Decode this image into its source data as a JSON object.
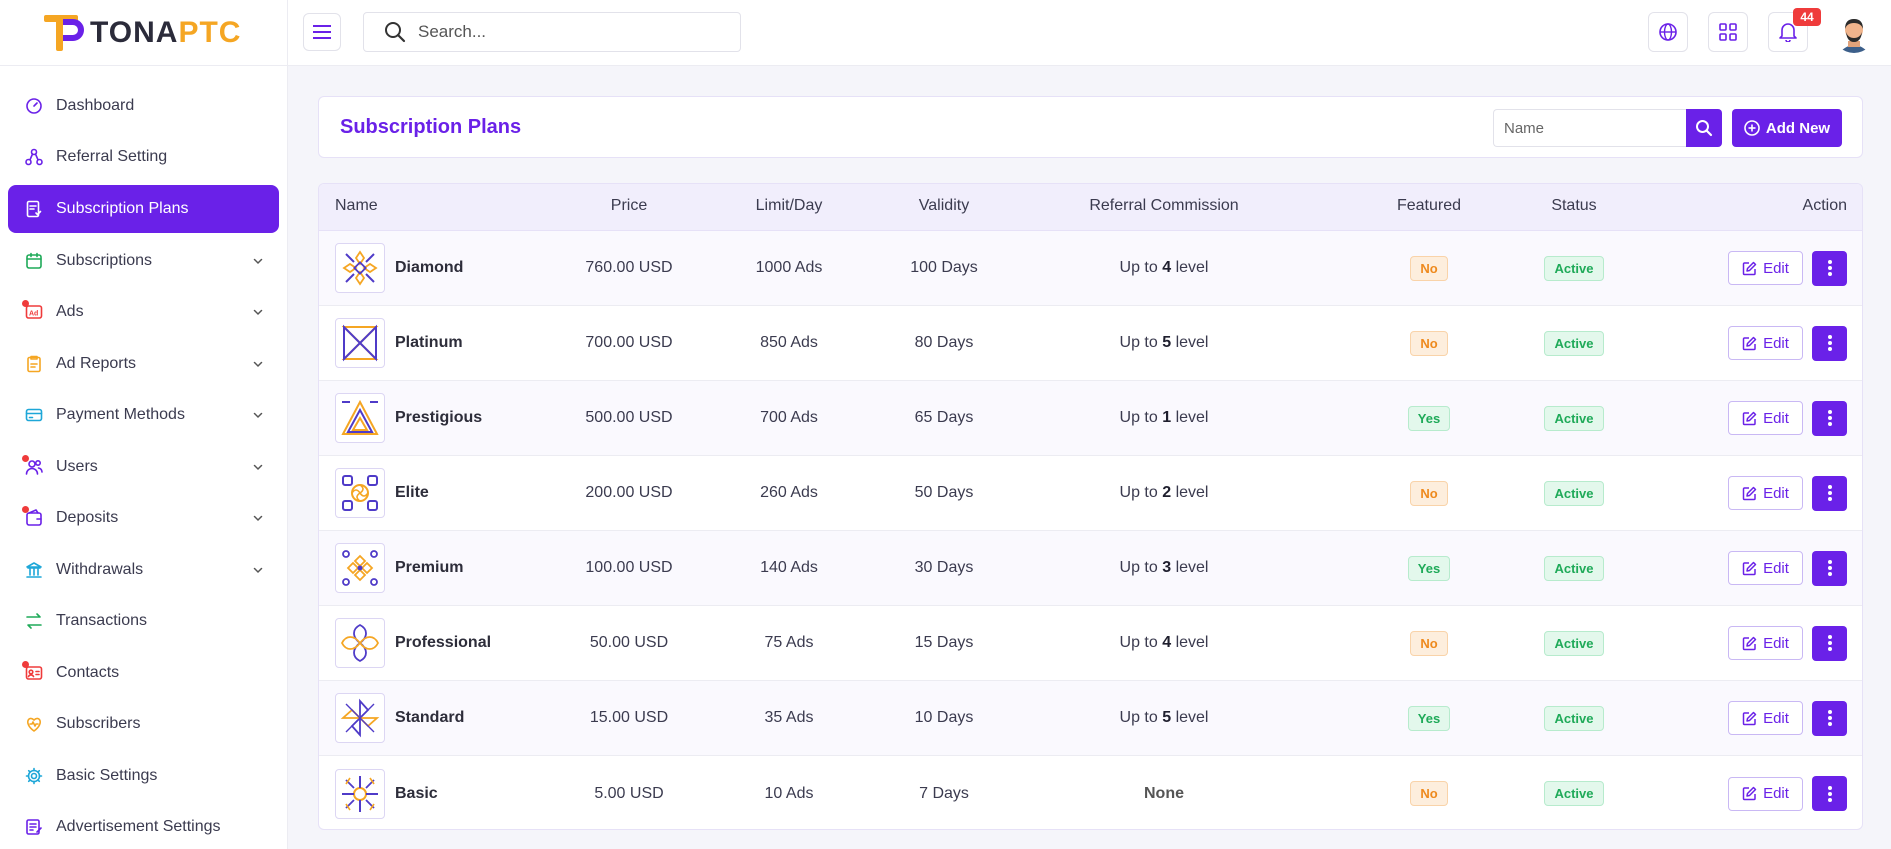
{
  "brand": {
    "name_part1": "TONA",
    "name_part2": "PTC"
  },
  "header": {
    "search_placeholder": "Search...",
    "notification_count": "44"
  },
  "sidebar": {
    "items": [
      {
        "label": "Dashboard",
        "icon": "dashboard-icon",
        "color": "#6a21e8",
        "has_chevron": false,
        "dot": false
      },
      {
        "label": "Referral Setting",
        "icon": "referral-icon",
        "color": "#6a21e8",
        "has_chevron": false,
        "dot": false
      },
      {
        "label": "Subscription Plans",
        "icon": "plans-icon",
        "color": "#ffffff",
        "has_chevron": false,
        "dot": false,
        "active": true
      },
      {
        "label": "Subscriptions",
        "icon": "subscriptions-icon",
        "color": "#1faa59",
        "has_chevron": true,
        "dot": false
      },
      {
        "label": "Ads",
        "icon": "ads-icon",
        "color": "#ef3b3b",
        "has_chevron": true,
        "dot": true
      },
      {
        "label": "Ad Reports",
        "icon": "ad-reports-icon",
        "color": "#f5a623",
        "has_chevron": true,
        "dot": false
      },
      {
        "label": "Payment Methods",
        "icon": "payment-icon",
        "color": "#1ea7d8",
        "has_chevron": true,
        "dot": false
      },
      {
        "label": "Users",
        "icon": "users-icon",
        "color": "#6a21e8",
        "has_chevron": true,
        "dot": true
      },
      {
        "label": "Deposits",
        "icon": "deposits-icon",
        "color": "#6a21e8",
        "has_chevron": true,
        "dot": true
      },
      {
        "label": "Withdrawals",
        "icon": "withdrawals-icon",
        "color": "#1ea7d8",
        "has_chevron": true,
        "dot": false
      },
      {
        "label": "Transactions",
        "icon": "transactions-icon",
        "color": "#1faa59",
        "has_chevron": false,
        "dot": false
      },
      {
        "label": "Contacts",
        "icon": "contacts-icon",
        "color": "#ef3b3b",
        "has_chevron": false,
        "dot": true
      },
      {
        "label": "Subscribers",
        "icon": "subscribers-icon",
        "color": "#f5a623",
        "has_chevron": false,
        "dot": false
      },
      {
        "label": "Basic Settings",
        "icon": "settings-icon",
        "color": "#1ea7d8",
        "has_chevron": false,
        "dot": false
      },
      {
        "label": "Advertisement Settings",
        "icon": "ad-settings-icon",
        "color": "#6a21e8",
        "has_chevron": false,
        "dot": false
      }
    ]
  },
  "page": {
    "title": "Subscription Plans",
    "name_filter_placeholder": "Name",
    "add_new_label": "Add New"
  },
  "table": {
    "headers": {
      "name": "Name",
      "price": "Price",
      "limit": "Limit/Day",
      "validity": "Validity",
      "referral": "Referral Commission",
      "featured": "Featured",
      "status": "Status",
      "action": "Action"
    },
    "edit_label": "Edit",
    "referral_prefix": "Up to",
    "referral_suffix": "level",
    "rows": [
      {
        "name": "Diamond",
        "price": "760.00 USD",
        "limit": "1000 Ads",
        "validity": "100 Days",
        "ref_level": "4",
        "ref_none": "",
        "featured": "No",
        "status": "Active"
      },
      {
        "name": "Platinum",
        "price": "700.00 USD",
        "limit": "850 Ads",
        "validity": "80 Days",
        "ref_level": "5",
        "ref_none": "",
        "featured": "No",
        "status": "Active"
      },
      {
        "name": "Prestigious",
        "price": "500.00 USD",
        "limit": "700 Ads",
        "validity": "65 Days",
        "ref_level": "1",
        "ref_none": "",
        "featured": "Yes",
        "status": "Active"
      },
      {
        "name": "Elite",
        "price": "200.00 USD",
        "limit": "260 Ads",
        "validity": "50 Days",
        "ref_level": "2",
        "ref_none": "",
        "featured": "No",
        "status": "Active"
      },
      {
        "name": "Premium",
        "price": "100.00 USD",
        "limit": "140 Ads",
        "validity": "30 Days",
        "ref_level": "3",
        "ref_none": "",
        "featured": "Yes",
        "status": "Active"
      },
      {
        "name": "Professional",
        "price": "50.00 USD",
        "limit": "75 Ads",
        "validity": "15 Days",
        "ref_level": "4",
        "ref_none": "",
        "featured": "No",
        "status": "Active"
      },
      {
        "name": "Standard",
        "price": "15.00 USD",
        "limit": "35 Ads",
        "validity": "10 Days",
        "ref_level": "5",
        "ref_none": "",
        "featured": "Yes",
        "status": "Active"
      },
      {
        "name": "Basic",
        "price": "5.00 USD",
        "limit": "10 Ads",
        "validity": "7 Days",
        "ref_level": "",
        "ref_none": "None",
        "featured": "No",
        "status": "Active"
      }
    ]
  },
  "colors": {
    "primary": "#6a21e8",
    "accent": "#f5a623"
  }
}
